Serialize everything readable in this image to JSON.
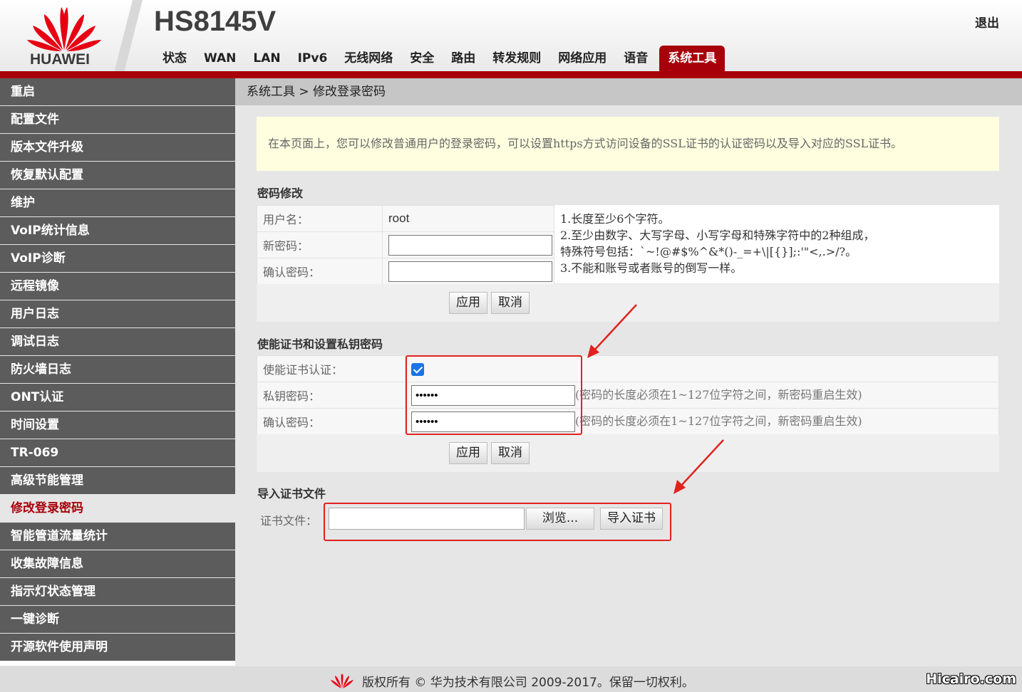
{
  "header": {
    "brand": "HUAWEI",
    "model": "HS8145V",
    "logout": "退出",
    "nav": [
      "状态",
      "WAN",
      "LAN",
      "IPv6",
      "无线网络",
      "安全",
      "路由",
      "转发规则",
      "网络应用",
      "语音",
      "系统工具"
    ],
    "active_nav": "系统工具"
  },
  "sidebar": {
    "items": [
      "重启",
      "配置文件",
      "版本文件升级",
      "恢复默认配置",
      "维护",
      "VoIP统计信息",
      "VoIP诊断",
      "远程镜像",
      "用户日志",
      "调试日志",
      "防火墙日志",
      "ONT认证",
      "时间设置",
      "TR-069",
      "高级节能管理",
      "修改登录密码",
      "智能管道流量统计",
      "收集故障信息",
      "指示灯状态管理",
      "一键诊断",
      "开源软件使用声明"
    ],
    "active": "修改登录密码"
  },
  "breadcrumb": "系统工具 > 修改登录密码",
  "info": "在本页面上，您可以修改普通用户的登录密码，可以设置https方式访问设备的SSL证书的认证密码以及导入对应的SSL证书。",
  "password_section": {
    "title": "密码修改",
    "username_label": "用户名：",
    "username_value": "root",
    "new_password_label": "新密码：",
    "confirm_password_label": "确认密码：",
    "hints": [
      "1.长度至少6个字符。",
      "2.至少由数字、大写字母、小写字母和特殊字符中的2种组成，",
      "特殊符号包括：`~!@#$%^&*()-_=+\\|[{}];:'\"<,.>/?。",
      "3.不能和账号或者账号的倒写一样。"
    ],
    "apply": "应用",
    "cancel": "取消"
  },
  "cert_section": {
    "title": "使能证书和设置私钥密码",
    "enable_label": "使能证书认证：",
    "enable_checked": true,
    "private_key_label": "私钥密码：",
    "private_key_value": "••••••",
    "confirm_label": "确认密码：",
    "confirm_value": "••••••",
    "note": "(密码的长度必须在1~127位字符之间，新密码重启生效)",
    "apply": "应用",
    "cancel": "取消"
  },
  "import_section": {
    "title": "导入证书文件",
    "file_label": "证书文件：",
    "browse": "浏览...",
    "import": "导入证书"
  },
  "footer": {
    "copyright": "版权所有 © 华为技术有限公司 2009-2017。保留一切权利。",
    "watermark": "Hicairo.com"
  },
  "colors": {
    "brand_red": "#a7000a",
    "annotation_red": "#e0231f",
    "sidebar_bg": "#5c5c5c",
    "info_bg": "#ffffe0"
  }
}
